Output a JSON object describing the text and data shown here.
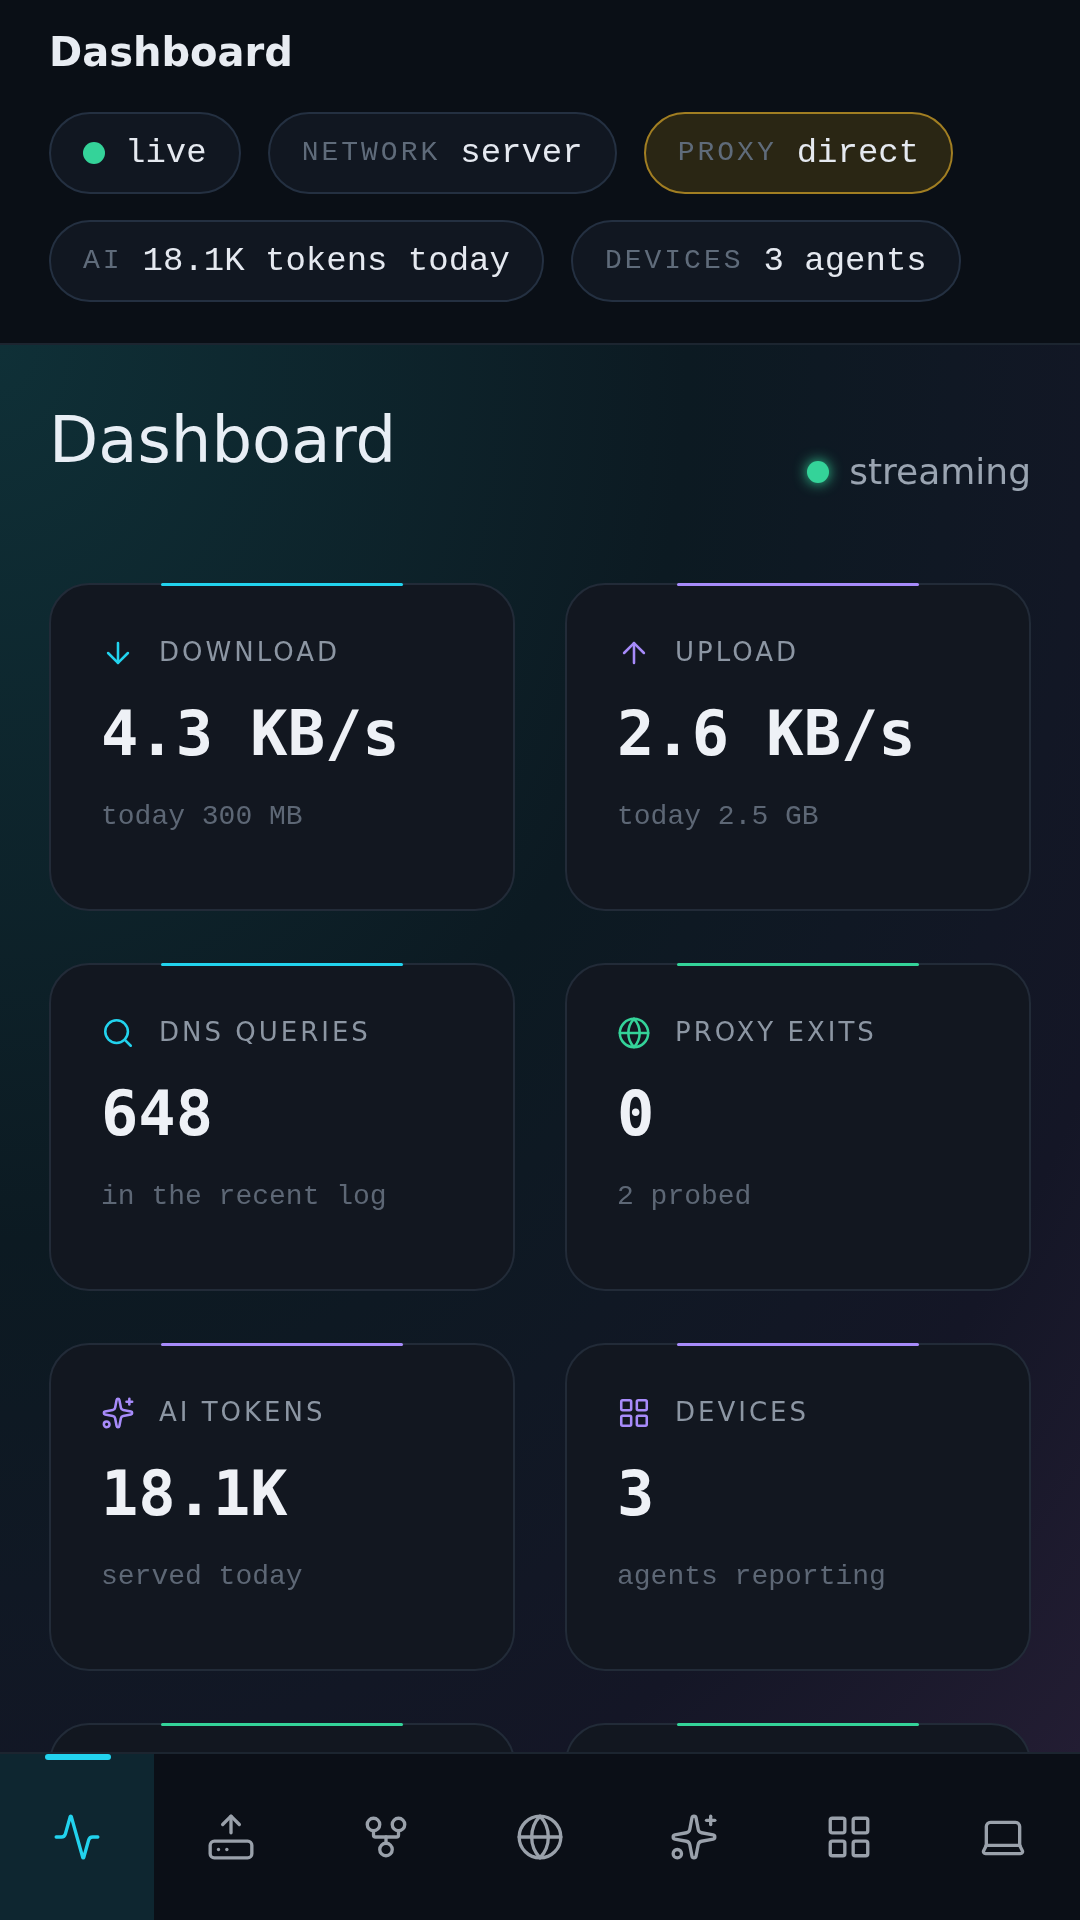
{
  "header": {
    "title": "Dashboard"
  },
  "chips": [
    {
      "kind": "status",
      "value": "live",
      "color": "#34d399",
      "highlighted": false
    },
    {
      "kind": "labeled",
      "label": "NETWORK",
      "value": "server",
      "highlighted": false
    },
    {
      "kind": "labeled",
      "label": "PROXY",
      "value": "direct",
      "highlighted": true
    },
    {
      "kind": "labeled",
      "label": "AI",
      "value": "18.1K tokens today",
      "highlighted": false
    },
    {
      "kind": "labeled",
      "label": "DEVICES",
      "value": "3 agents",
      "highlighted": false
    }
  ],
  "main": {
    "title": "Dashboard",
    "status": {
      "text": "streaming",
      "color": "#34d399"
    }
  },
  "cards": [
    {
      "kind": "download",
      "label": "DOWNLOAD",
      "value": "4.3 KB/s",
      "sub": "today 300 MB",
      "color": "#22d3ee"
    },
    {
      "kind": "upload",
      "label": "UPLOAD",
      "value": "2.6 KB/s",
      "sub": "today 2.5 GB",
      "color": "#a78bfa"
    },
    {
      "kind": "dns",
      "label": "DNS QUERIES",
      "value": "648",
      "sub": "in the recent log",
      "color": "#22d3ee"
    },
    {
      "kind": "proxy",
      "label": "PROXY EXITS",
      "value": "0",
      "sub": "2 probed",
      "color": "#34d399"
    },
    {
      "kind": "ai",
      "label": "AI TOKENS",
      "value": "18.1K",
      "sub": "served today",
      "color": "#a78bfa"
    },
    {
      "kind": "devices",
      "label": "DEVICES",
      "value": "3",
      "sub": "agents reporting",
      "color": "#a78bfa"
    },
    {
      "kind": "hidden",
      "color": "#34d399"
    },
    {
      "kind": "hidden",
      "color": "#34d399"
    }
  ],
  "nav": [
    {
      "kind": "activity",
      "selected": true
    },
    {
      "kind": "upload",
      "selected": false
    },
    {
      "kind": "fork",
      "selected": false
    },
    {
      "kind": "globe",
      "selected": false
    },
    {
      "kind": "sparkles",
      "selected": false
    },
    {
      "kind": "grid",
      "selected": false
    },
    {
      "kind": "laptop",
      "selected": false
    }
  ]
}
